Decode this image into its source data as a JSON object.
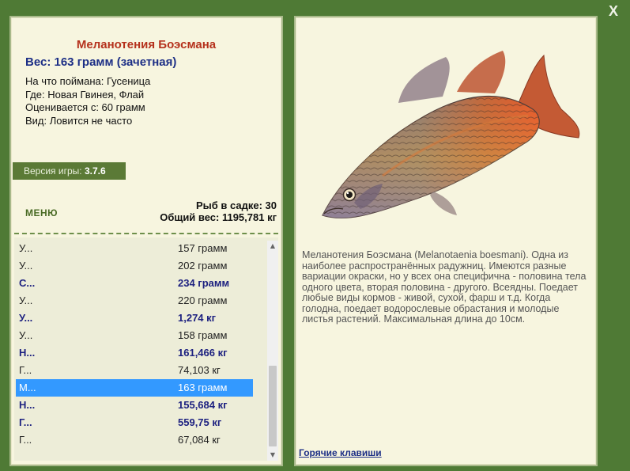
{
  "fish": {
    "name": "Меланотения Боэсмана",
    "weight": "Вес: 163 грамм (зачетная)",
    "info": [
      "На что поймана: Гусеница",
      "Где: Новая Гвинея, Флай",
      "Оценивается с: 60 грамм",
      "Вид: Ловится не часто"
    ],
    "description": "Меланотения Боэсмана (Melanotaenia boesmani). Одна из наиболее распространённых радужниц. Имеются разные вариации окраски, но у всех она специфична - половина тела одного цвета, вторая половина - другого. Всеядны. Поедает любые виды кормов - живой, сухой, фарш и т.д. Когда голодна, поедает водорослевые обрастания и молодые листья растений. Максимальная длина до 10см."
  },
  "version": {
    "label": "Версия игры:",
    "value": "3.7.6"
  },
  "menu_label": "МЕНЮ",
  "stats": {
    "fish_count": "Рыб в садке: 30",
    "total_weight": "Общий вес: 1195,781 кг"
  },
  "catch_list": [
    {
      "name": "Удильщик разукрашенный",
      "weight": "157 грамм",
      "bold": false,
      "selected": false
    },
    {
      "name": "Удильщик разукрашенный",
      "weight": "202 грамм",
      "bold": false,
      "selected": false
    },
    {
      "name": "Скорпена Эчмейера",
      "weight": "234 грамм",
      "bold": true,
      "selected": false
    },
    {
      "name": "Удильщик разукрашенный",
      "weight": "220 грамм",
      "bold": false,
      "selected": false
    },
    {
      "name": "Удильщик разукрашенный",
      "weight": "1,274 кг",
      "bold": true,
      "selected": false
    },
    {
      "name": "Удильщик разукрашенный",
      "weight": "158 грамм",
      "bold": false,
      "selected": false
    },
    {
      "name": "Новогвинейский крокодил",
      "weight": "161,466 кг",
      "bold": true,
      "selected": false
    },
    {
      "name": "Гребнистый крокодил",
      "weight": "74,103 кг",
      "bold": false,
      "selected": false
    },
    {
      "name": "Меланотения Боэсмана",
      "weight": "163 грамм",
      "bold": false,
      "selected": true
    },
    {
      "name": "Новогвинейский крокодил",
      "weight": "155,684 кг",
      "bold": true,
      "selected": false
    },
    {
      "name": "Гребнистый крокодил",
      "weight": "559,75 кг",
      "bold": true,
      "selected": false
    },
    {
      "name": "Гребнистый крокодил",
      "weight": "67,084 кг",
      "bold": false,
      "selected": false
    }
  ],
  "hotkeys_label": "Горячие клавиши",
  "close_label": "X",
  "icons": {
    "close": "close-icon",
    "scroll_up": "arrow-up-icon",
    "scroll_down": "arrow-down-icon"
  },
  "colors": {
    "background": "#4f7a35",
    "panel": "#f7f5df",
    "title": "#b5311c",
    "accent_blue": "#1d2f86",
    "selection": "#3399ff"
  }
}
